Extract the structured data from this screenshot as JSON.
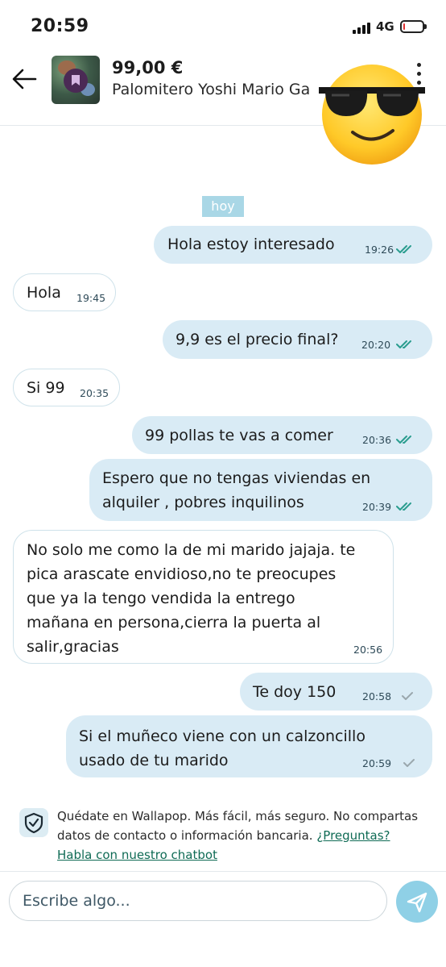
{
  "status_bar": {
    "time": "20:59",
    "network": "4G",
    "battery_level": 0.08
  },
  "header": {
    "price": "99,00 €",
    "title": "Palomitero Yoshi Mario Ga"
  },
  "chat": {
    "day_label": "hoy",
    "messages": [
      {
        "direction": "out",
        "lines": [
          "Hola estoy interesado"
        ],
        "time": "19:26",
        "status": "read"
      },
      {
        "direction": "in",
        "lines": [
          "Hola"
        ],
        "time": "19:45"
      },
      {
        "direction": "out",
        "lines": [
          "9,9 es el precio final?"
        ],
        "time": "20:20",
        "status": "read"
      },
      {
        "direction": "in",
        "lines": [
          "Si 99"
        ],
        "time": "20:35"
      },
      {
        "direction": "out",
        "lines": [
          "99 pollas te vas a comer"
        ],
        "time": "20:36",
        "status": "read"
      },
      {
        "direction": "out",
        "lines": [
          "Espero que no tengas viviendas en",
          "alquiler , pobres inquilinos"
        ],
        "time": "20:39",
        "status": "read"
      },
      {
        "direction": "in",
        "lines": [
          "No solo me como la de mi marido jajaja. te",
          "pica arascate envidioso,no te preocupes",
          "que ya la tengo vendida la entrego",
          "mañana en persona,cierra la puerta al",
          "salir,gracias"
        ],
        "time": "20:56"
      },
      {
        "direction": "out",
        "lines": [
          "Te doy 150"
        ],
        "time": "20:58",
        "status": "sent"
      },
      {
        "direction": "out",
        "lines": [
          "Si el muñeco viene con un calzoncillo",
          "usado de tu marido"
        ],
        "time": "20:59",
        "status": "sent"
      }
    ]
  },
  "disclaimer": {
    "line1": "Quédate en Wallapop. Más fácil, más seguro. No compartas",
    "line2_text": "datos de contacto o información bancaria. ",
    "line2_link": "¿Preguntas?",
    "line3_link": "Habla con nuestro chatbot"
  },
  "composer": {
    "placeholder": "Escribe algo..."
  },
  "colors": {
    "outgoing_bubble": "#d9ebf5",
    "read_ticks": "#2a9d8f",
    "sent_ticks": "#9aa7ad",
    "send_button": "#8fd0e6",
    "link": "#0f6b55"
  },
  "icons": [
    "back-arrow-icon",
    "more-vertical-icon",
    "sunglasses-emoji",
    "shield-check-icon",
    "send-icon"
  ]
}
